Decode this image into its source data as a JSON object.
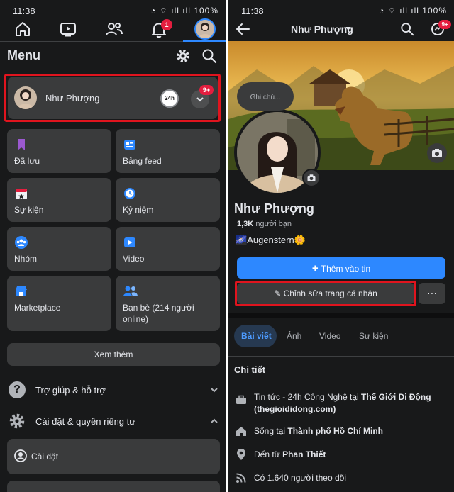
{
  "status": {
    "time": "11:38",
    "battery": "100%"
  },
  "left": {
    "nav_badge": "1",
    "menu_title": "Menu",
    "profile_name": "Như Phượng",
    "profile_badge": "9+",
    "profile_mini": "24h",
    "shortcuts": [
      {
        "label": "Đã lưu",
        "icon": "bookmark-icon",
        "color": "#9b59d0"
      },
      {
        "label": "Bảng feed",
        "icon": "feed-icon",
        "color": "#2d88ff"
      },
      {
        "label": "Sự kiện",
        "icon": "calendar-icon",
        "color": "#e41e3f"
      },
      {
        "label": "Kỷ niệm",
        "icon": "clock-icon",
        "color": "#2d88ff"
      },
      {
        "label": "Nhóm",
        "icon": "groups-icon",
        "color": "#2d88ff"
      },
      {
        "label": "Video",
        "icon": "video-icon",
        "color": "#2d88ff"
      },
      {
        "label": "Marketplace",
        "icon": "marketplace-icon",
        "color": "#2d88ff"
      },
      {
        "label": "Bạn bè (214 người online)",
        "icon": "friends-icon",
        "color": "#2d88ff"
      }
    ],
    "see_more": "Xem thêm",
    "help": "Trợ giúp & hỗ trợ",
    "settings_privacy": "Cài đặt & quyền riêng tư",
    "settings": "Cài đặt"
  },
  "right": {
    "header_name": "Như Phượng",
    "header_badge": "9+",
    "note_placeholder": "Ghi chú...",
    "name": "Như Phượng",
    "friends_count": "1,3K",
    "friends_label": "người bạn",
    "bio_text": "Augenstern",
    "add_story": "Thêm vào tin",
    "edit_profile": "Chỉnh sửa trang cá nhân",
    "more": "···",
    "tabs": [
      "Bài viết",
      "Ảnh",
      "Video",
      "Sự kiện"
    ],
    "details_title": "Chi tiết",
    "work_prefix": "Tin tức - 24h Công Nghệ tại ",
    "work_company": "Thế Giới Di Động",
    "work_site": "(thegioididong.com)",
    "lives_prefix": "Sống tại ",
    "lives_place": "Thành phố Hồ Chí Minh",
    "from_prefix": "Đến từ ",
    "from_place": "Phan Thiết",
    "followers": "Có 1.640 người theo dõi"
  },
  "colors": {
    "bg": "#18191a",
    "card": "#3a3b3c",
    "accent": "#2d88ff",
    "highlight": "#e0141e"
  }
}
